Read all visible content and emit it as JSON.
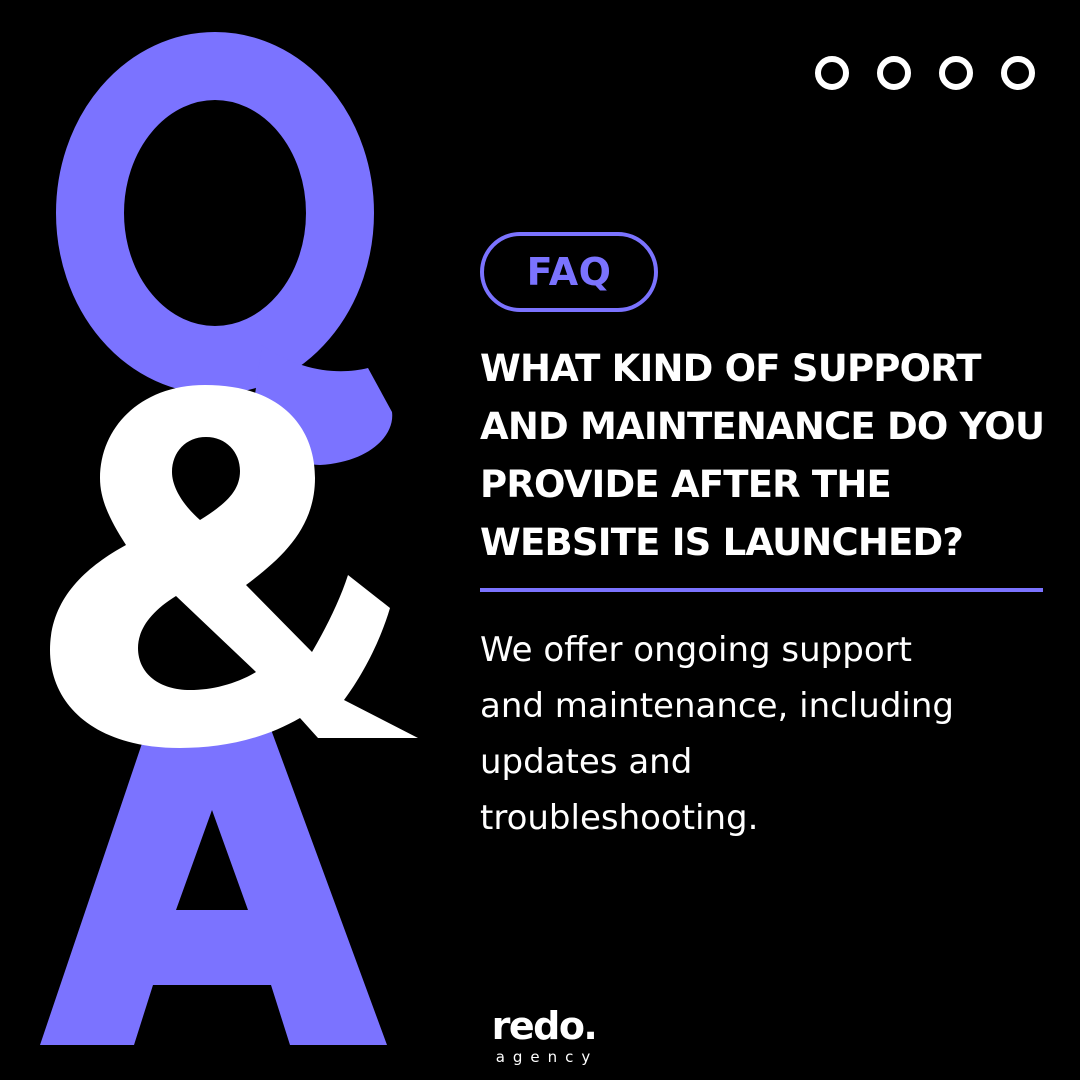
{
  "colors": {
    "background": "#000000",
    "accent": "#7b73ff",
    "text": "#ffffff"
  },
  "pagination": {
    "dots": 4
  },
  "badge": {
    "label": "FAQ"
  },
  "question": {
    "lines": [
      "WHAT KIND OF SUPPORT",
      "AND MAINTENANCE DO YOU",
      "PROVIDE AFTER THE",
      "WEBSITE IS LAUNCHED?"
    ]
  },
  "answer": {
    "lines": [
      "We offer ongoing support",
      "and maintenance, including",
      "updates and",
      "troubleshooting."
    ]
  },
  "graphic": {
    "letter_top": "Q",
    "ampersand": "&",
    "letter_bottom": "A"
  },
  "logo": {
    "word": "redo.",
    "sub": "agency"
  }
}
